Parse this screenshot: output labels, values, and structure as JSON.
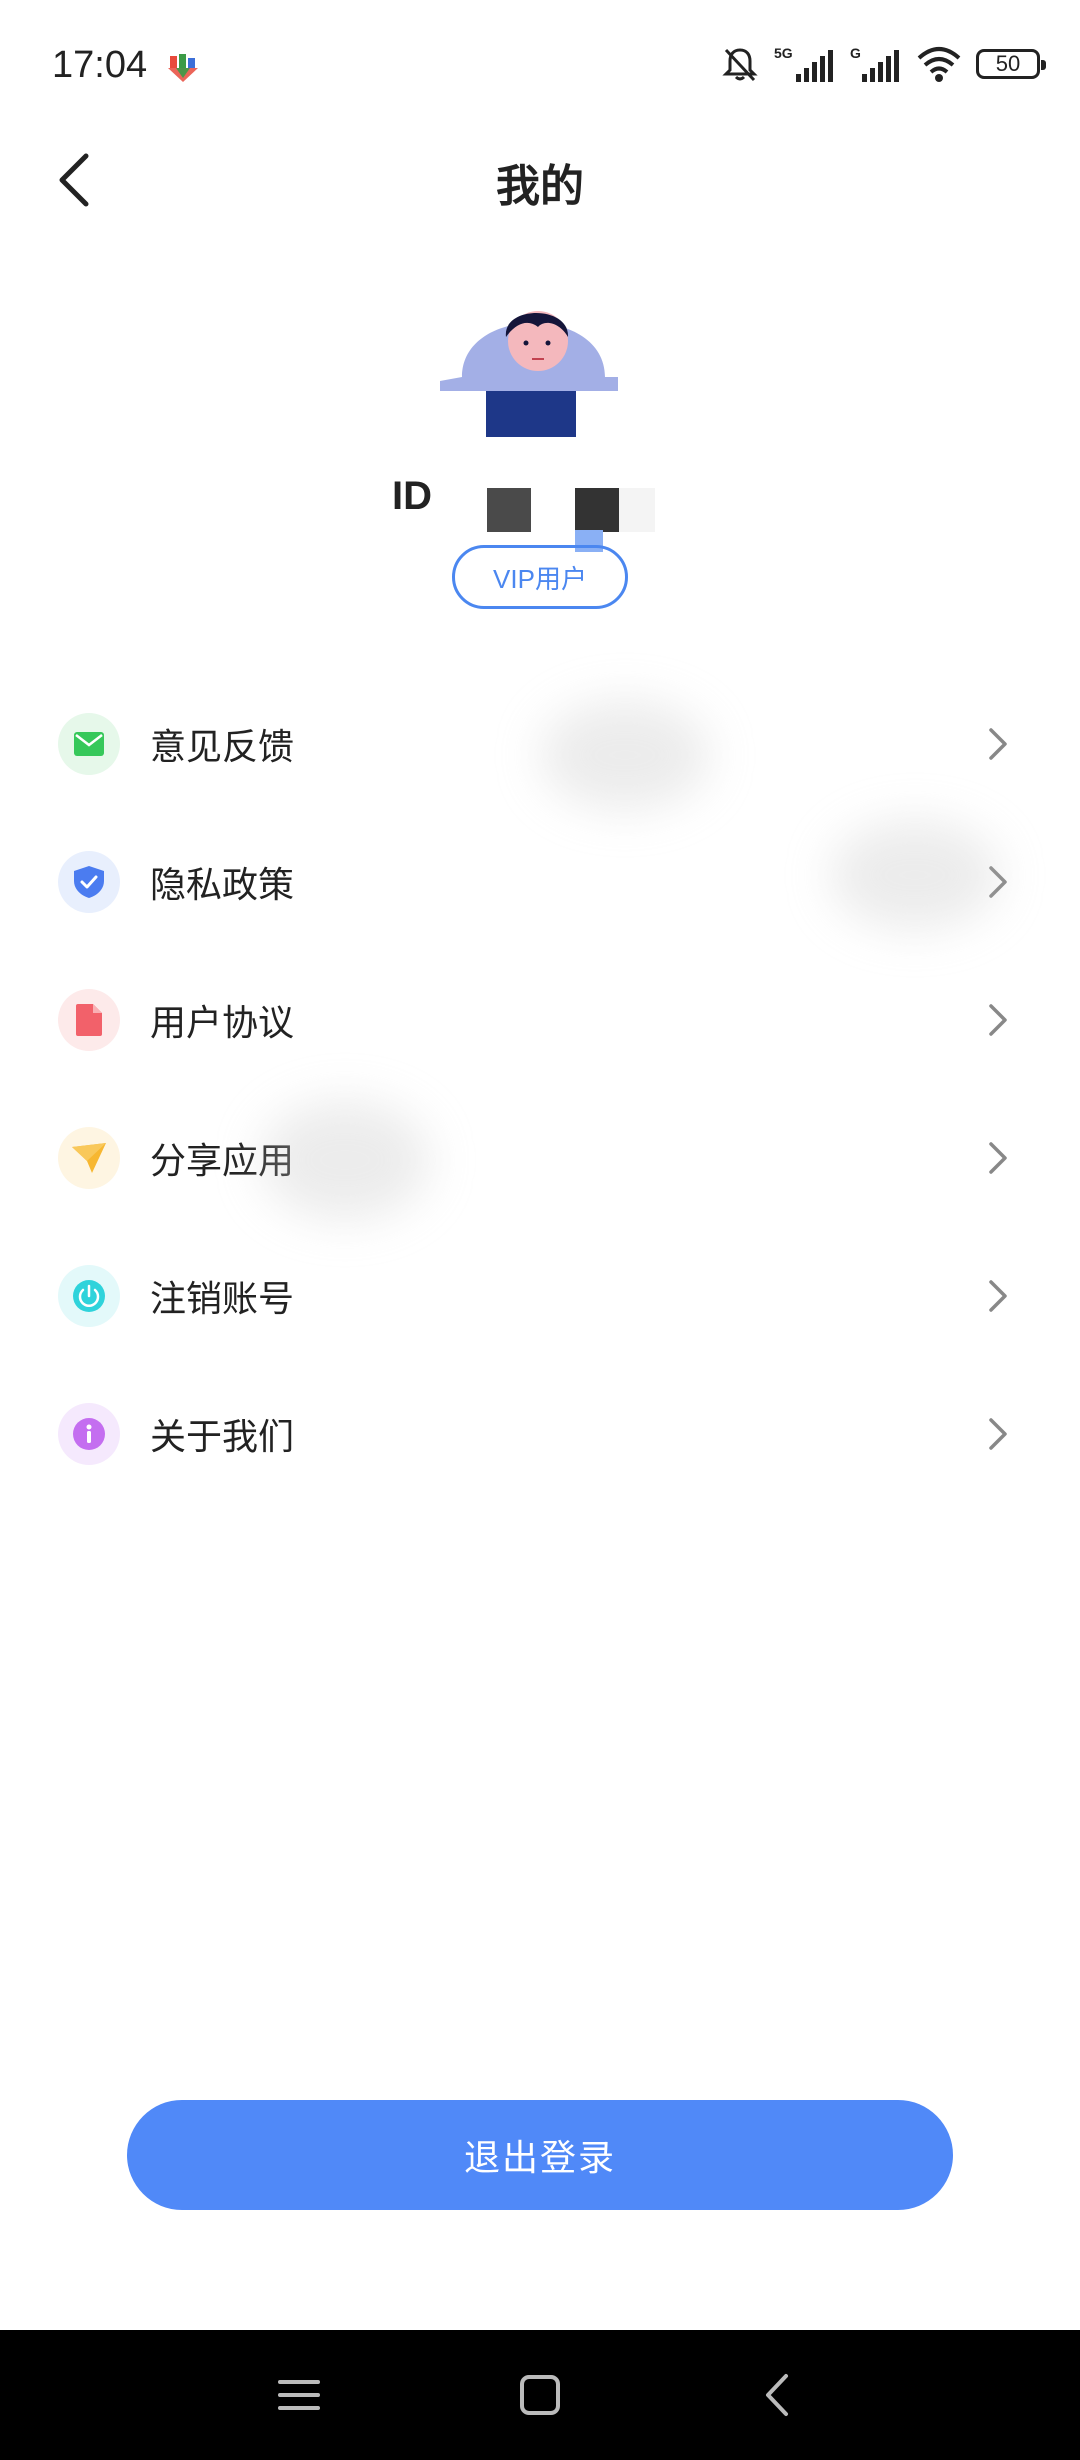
{
  "status_bar": {
    "time": "17:04",
    "icons": [
      "app-notification-icon",
      "mute-bell-icon",
      "signal-5g-icon",
      "signal-g-icon",
      "wifi-icon"
    ],
    "network_1": "5G",
    "network_2": "G",
    "battery": "50"
  },
  "header": {
    "title": "我的",
    "back_icon": "chevron-left-icon"
  },
  "profile": {
    "id_label": "ID",
    "badge": "VIP用户",
    "avatar_icon": "user-avatar-illustration"
  },
  "menu": {
    "items": [
      {
        "label": "意见反馈",
        "icon": "mail-icon",
        "icon_color": "#36c85a",
        "icon_bg": "#e6f8ea"
      },
      {
        "label": "隐私政策",
        "icon": "shield-check-icon",
        "icon_color": "#4b7cf0",
        "icon_bg": "#e8effd"
      },
      {
        "label": "用户协议",
        "icon": "document-icon",
        "icon_color": "#f2616a",
        "icon_bg": "#fdeaea"
      },
      {
        "label": "分享应用",
        "icon": "paper-plane-icon",
        "icon_color": "#f7b731",
        "icon_bg": "#fef5e2"
      },
      {
        "label": "注销账号",
        "icon": "power-icon",
        "icon_color": "#2fd3db",
        "icon_bg": "#e3f9fa"
      },
      {
        "label": "关于我们",
        "icon": "info-icon",
        "icon_color": "#c46ef0",
        "icon_bg": "#f5e9fd"
      }
    ]
  },
  "logout": {
    "label": "退出登录"
  },
  "colors": {
    "accent": "#5089f8",
    "badge": "#4b87f0"
  },
  "nav_bar": {
    "buttons": [
      "menu-icon",
      "home-square-icon",
      "back-triangle-icon"
    ]
  }
}
